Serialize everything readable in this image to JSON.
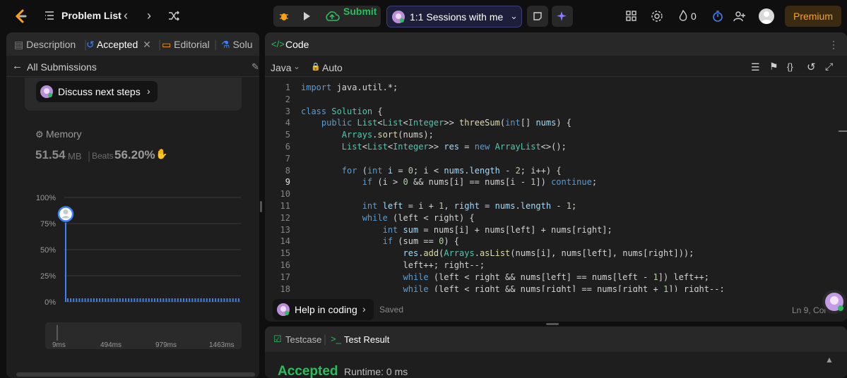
{
  "topbar": {
    "problem_list": "Problem List",
    "submit": "Submit",
    "session": "1:1 Sessions with me",
    "streak": "0",
    "premium": "Premium"
  },
  "left": {
    "tabs": [
      "Description",
      "Accepted",
      "Editorial",
      "Solu"
    ],
    "all_submissions": "All Submissions",
    "discuss": "Discuss next steps",
    "memory_label": "Memory",
    "memory_value": "51.54",
    "memory_unit": "MB",
    "beats_label": "Beats",
    "beats_value": "56.20%",
    "chart": {
      "y_ticks": [
        "100%",
        "75%",
        "50%",
        "25%",
        "0%"
      ],
      "x_ticks": [
        "9ms",
        "494ms",
        "979ms",
        "1463ms"
      ],
      "minimap_ticks": [
        "9ms",
        "494ms",
        "979ms",
        "1463ms"
      ]
    }
  },
  "chart_data": {
    "type": "bar",
    "x": [
      "9ms",
      "494ms",
      "979ms",
      "1463ms"
    ],
    "ylim": [
      0,
      100
    ],
    "y_ticks": [
      "100%",
      "75%",
      "50%",
      "25%",
      "0%"
    ],
    "highlighted": {
      "x": "9ms",
      "y": 76
    }
  },
  "code": {
    "title": "Code",
    "language": "Java",
    "auto": "Auto",
    "lines": [
      {
        "n": "1",
        "html": "<span class=\"kw\">import</span> java.util.*;"
      },
      {
        "n": "2",
        "html": ""
      },
      {
        "n": "3",
        "html": "<span class=\"kw\">class</span> <span class=\"ty\">Solution</span> {"
      },
      {
        "n": "4",
        "html": "    <span class=\"kw\">public</span> <span class=\"ty\">List</span>&lt;<span class=\"ty\">List</span>&lt;<span class=\"ty\">Integer</span>&gt;&gt; <span class=\"fn\">threeSum</span>(<span class=\"kw\">int</span>[] <span class=\"var\">nums</span>) {"
      },
      {
        "n": "5",
        "html": "        <span class=\"ty\">Arrays</span>.<span class=\"fn\">sort</span>(nums);"
      },
      {
        "n": "6",
        "html": "        <span class=\"ty\">List</span>&lt;<span class=\"ty\">List</span>&lt;<span class=\"ty\">Integer</span>&gt;&gt; <span class=\"var\">res</span> = <span class=\"kw\">new</span> <span class=\"ty\">ArrayList</span>&lt;&gt;();"
      },
      {
        "n": "7",
        "html": ""
      },
      {
        "n": "8",
        "html": "        <span class=\"kw\">for</span> (<span class=\"kw\">int</span> <span class=\"var\">i</span> = <span class=\"nm\">0</span>; i &lt; <span class=\"var\">nums</span>.<span class=\"var\">length</span> - <span class=\"nm\">2</span>; i++) {"
      },
      {
        "n": "9",
        "html": "            <span class=\"kw\">if</span> (i &gt; <span class=\"nm\">0</span> &amp;&amp; nums[i] == nums[i - <span class=\"nm\">1</span>]) <span class=\"kw\">continue</span>;"
      },
      {
        "n": "10",
        "html": ""
      },
      {
        "n": "11",
        "html": "            <span class=\"kw\">int</span> <span class=\"var\">left</span> = i + <span class=\"nm\">1</span>, <span class=\"var\">right</span> = <span class=\"var\">nums</span>.<span class=\"var\">length</span> - <span class=\"nm\">1</span>;"
      },
      {
        "n": "12",
        "html": "            <span class=\"kw\">while</span> (left &lt; right) {"
      },
      {
        "n": "13",
        "html": "                <span class=\"kw\">int</span> <span class=\"var\">sum</span> = nums[i] + nums[left] + nums[right];"
      },
      {
        "n": "14",
        "html": "                <span class=\"kw\">if</span> (sum == <span class=\"nm\">0</span>) {"
      },
      {
        "n": "15",
        "html": "                    <span class=\"var\">res</span>.<span class=\"fn\">add</span>(<span class=\"ty\">Arrays</span>.<span class=\"fn\">asList</span>(nums[i], nums[left], nums[right]));"
      },
      {
        "n": "16",
        "html": "                    left++; right--;"
      },
      {
        "n": "17",
        "html": "                    <span class=\"kw\">while</span> (left &lt; right &amp;&amp; nums[left] == nums[left - <span class=\"nm\">1</span>]) left++;"
      },
      {
        "n": "18",
        "html": "                    <span class=\"kw\">while</span> (left &lt; right &amp;&amp; nums[right] == nums[right + <span class=\"nm\">1</span>]) right--;"
      }
    ],
    "current_line": "9",
    "help": "Help in coding",
    "saved": "Saved",
    "position": "Ln 9, Col 6"
  },
  "test": {
    "testcase": "Testcase",
    "test_result": "Test Result",
    "accepted": "Accepted",
    "runtime": "Runtime: 0 ms"
  },
  "colors": {
    "accent_green": "#2cbb5d",
    "accent_orange": "#ffa116",
    "bar_blue": "#3b82f6"
  }
}
